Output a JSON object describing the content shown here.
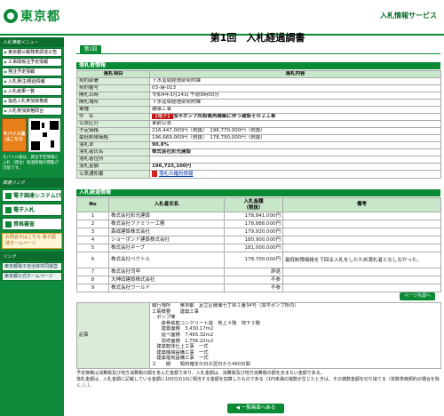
{
  "header": {
    "logo_text": "東京都",
    "service_name": "入札情報サービス"
  },
  "sidebar": {
    "heading": "入札情報メニュー",
    "menu": [
      "東京都公報発表調達公告",
      "工事関係注予定情報",
      "発注予定情報",
      "入札発注/経過情報",
      "入札結果一覧",
      "指名入札参加資格者",
      "入札参加資格問合"
    ],
    "mobile_label": "モバイル版はこちら",
    "mobile_note": "モバイル版は、発注予定情報と入札（発注）経過情報の閲覧が可能です。",
    "heading2": "関連リンク",
    "buttons": [
      "電子調達システム(TOP)",
      "電子入札",
      "資格審査"
    ],
    "orange_box": "お問合せはこちら\n電子調達ホームページ",
    "heading3": "リンク",
    "links": [
      "東京都電子自治体共同運営",
      "東京都公式ホームページ"
    ]
  },
  "main": {
    "title": "第1回　入札経過調書",
    "tab_label": "第1回",
    "section1_title": "落札者情報",
    "table1_headers": [
      "落札項目",
      "落札内容"
    ],
    "table1_rows": [
      {
        "label": "契約部署",
        "value": "下水道局経理部契約課"
      },
      {
        "label": "契約番号",
        "value": "03-港-013"
      },
      {
        "label": "開札日時",
        "value": "令和4年3月24日 午前9時00分"
      },
      {
        "label": "開札場所",
        "value": "下水道局経理部契約課"
      },
      {
        "label": "業種",
        "value": "建築工事"
      },
      {
        "label": "件　名",
        "value": "加平ポンプ所設備再構築に伴う建設その２工事",
        "badge": "【電子】"
      },
      {
        "label": "公表区分",
        "value": "事前公表"
      },
      {
        "label": "予定価格",
        "value": "216,447,000円（税抜）　196,770,000円（税抜）"
      },
      {
        "label": "最低制限価格",
        "value": "196,669,000円（税抜）　178,790,000円（税抜）"
      },
      {
        "label": "落札率",
        "value": "90.8%"
      },
      {
        "label": "落札者氏名",
        "value": "株式会社彩光建設"
      },
      {
        "label": "落札者住所",
        "value": ""
      },
      {
        "label": "落札金額",
        "value": "196,725,100円"
      },
      {
        "label": "公表通知書",
        "value": "落札の確約情報"
      }
    ],
    "section2_title": "入札経過情報",
    "table2_headers": [
      "No",
      "入札者氏名",
      "入札金額\n（税抜）",
      "備考"
    ],
    "table2_rows": [
      {
        "no": "1",
        "name": "株式会社彩光建設",
        "amount": "178,841,000円",
        "note": ""
      },
      {
        "no": "2",
        "name": "株式会社ファミリー工務",
        "amount": "178,888,000円",
        "note": ""
      },
      {
        "no": "3",
        "name": "森成建設株式会社",
        "amount": "179,930,000円",
        "note": ""
      },
      {
        "no": "4",
        "name": "ショーボンド建設株式会社",
        "amount": "180,900,000円",
        "note": ""
      },
      {
        "no": "5",
        "name": "株式会社ネーブ",
        "amount": "181,000,000円",
        "note": ""
      },
      {
        "no": "6",
        "name": "株式会社ベクトル",
        "amount": "178,700,000円",
        "note": "最低制限価格を下回る入札をしたため落札者となしなかった。"
      },
      {
        "no": "7",
        "name": "株式会社司甲",
        "amount": "辞退",
        "note": ""
      },
      {
        "no": "8",
        "name": "大神田建設株式会社",
        "amount": "不参",
        "note": ""
      },
      {
        "no": "9",
        "name": "株式会社ワールド",
        "amount": "不参",
        "note": ""
      }
    ],
    "next_button": "ページ先頭へ",
    "remarks_label": "記事",
    "remarks_text": "履行場所　　東京都　足立区綾瀬七丁目１番34号（加平ポンプ所内）\n工事概要　　建築工事\n　ポンプ棟\n　　鉄骨鉄筋コンクリート造　地上４階　地下３階\n　　建築面積　3,430.17m2\n　　延べ面積　7,465.32m2\n　　改修面積　1,756.22m2\n　建築躯体仕上工事　一式\n　建築機械設備工事　一式\n　建築電気設備工事　一式\n工　　期　　契約確定の日の翌日から460日間",
    "footnote": "予定価格は消費税及び地方消費税の額を含んだ金額であり、入札金額は、消費税及び地方消費税の額を含まない金額である。\n落札金額は、入札金額に記載している金額に100分の10に相当する金額を加算したものである（1円未満の端数が生じたときは、その端数金額を切り捨てる（单数単価契約の場合を除く。）。）。",
    "back_button": "◀ 一覧画面へ戻る"
  },
  "colors": {
    "brand_green": "#0a8a34",
    "label_bg": "#d8ecd8",
    "badge_red": "#c81818"
  }
}
